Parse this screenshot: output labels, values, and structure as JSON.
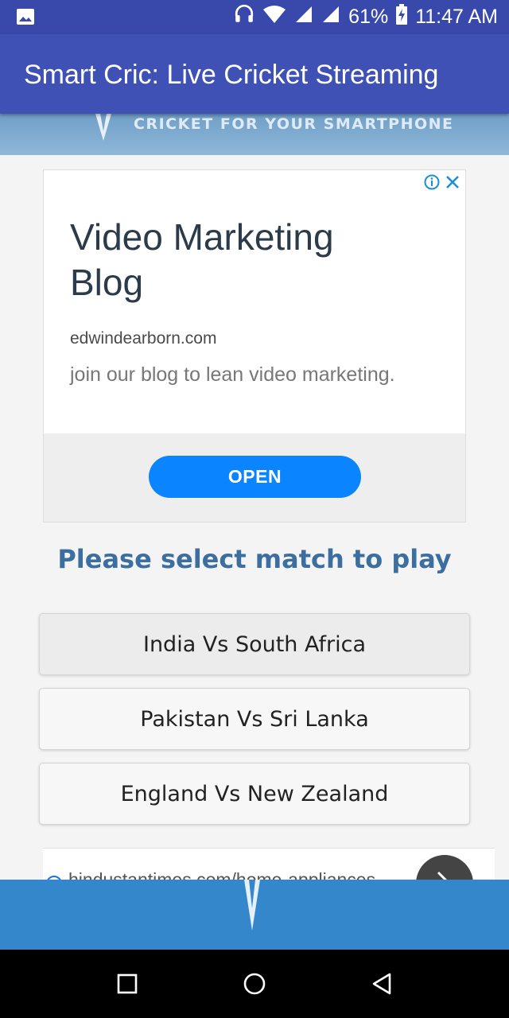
{
  "status_bar": {
    "battery_percent": "61%",
    "time": "11:47 AM",
    "icons": [
      "image-icon",
      "headphones-icon",
      "wifi-icon",
      "signal-icon",
      "signal-icon",
      "battery-charging-icon"
    ]
  },
  "app_bar": {
    "title": "Smart Cric: Live Cricket Streaming"
  },
  "banner": {
    "tagline": "CRICKET FOR YOUR SMARTPHONE"
  },
  "ad": {
    "headline": "Video Marketing Blog",
    "domain": "edwindearborn.com",
    "description": "join our blog to lean video marketing.",
    "cta_label": "OPEN",
    "icons": [
      "adchoices-info-icon",
      "close-icon"
    ]
  },
  "main": {
    "heading": "Please select match to play",
    "matches": [
      {
        "label": "India Vs South Africa"
      },
      {
        "label": "Pakistan Vs Sri Lanka"
      },
      {
        "label": "England Vs New Zealand"
      }
    ]
  },
  "ad2": {
    "url": "hindustantimes.com/home-appliances"
  },
  "colors": {
    "status_bar": "#3949ab",
    "app_bar": "#3f51b5",
    "accent_heading": "#3c6fa0",
    "cta_button": "#0a84ff",
    "bottom_banner": "#3387ca"
  }
}
